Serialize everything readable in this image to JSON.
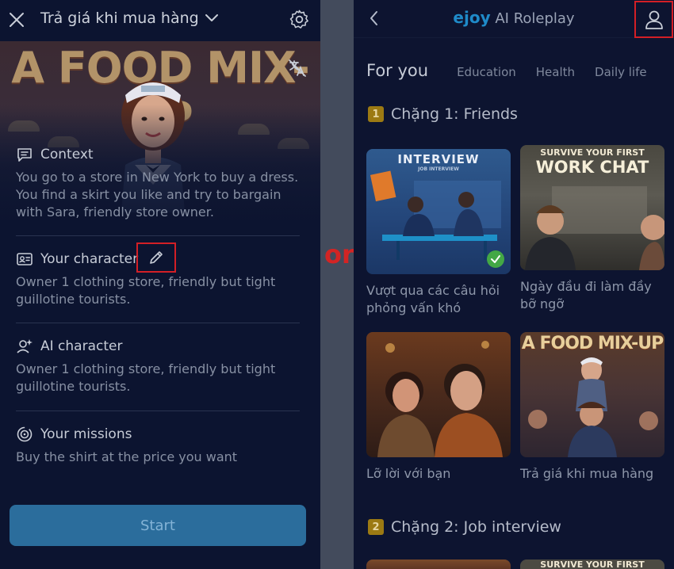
{
  "left": {
    "title": "Trả giá khi mua hàng",
    "hero_text": "A FOOD MIX-UP",
    "sections": [
      {
        "icon": "context-icon",
        "label": "Context",
        "body": "You go to a store in New York to buy a dress. You find a skirt you like and try to bargain with Sara, friendly store owner."
      },
      {
        "icon": "your-character-icon",
        "label": "Your character",
        "body": "Owner 1 clothing store, friendly but tight guillotine tourists."
      },
      {
        "icon": "ai-character-icon",
        "label": "AI character",
        "body": "Owner 1 clothing store, friendly but tight guillotine tourists."
      },
      {
        "icon": "missions-icon",
        "label": "Your missions",
        "body": "Buy the shirt at the price you want"
      }
    ],
    "start_label": "Start"
  },
  "separator_text": "or",
  "right": {
    "brand_logo": "ejoy",
    "brand_suffix": "AI Roleplay",
    "tabs": [
      {
        "label": "For you",
        "active": true
      },
      {
        "label": "Education",
        "active": false
      },
      {
        "label": "Health",
        "active": false
      },
      {
        "label": "Daily life",
        "active": false
      }
    ],
    "chapters": [
      {
        "num": "1",
        "title": "Chặng 1: Friends"
      },
      {
        "num": "2",
        "title": "Chặng 2: Job interview"
      }
    ],
    "cards": [
      {
        "image_text": "INTERVIEW",
        "image_subtext": "JOB INTERVIEW",
        "caption": "Vượt qua các câu hỏi phỏng vấn khó",
        "completed": true
      },
      {
        "image_text": "SURVIVE YOUR FIRST",
        "image_text2": "WORK CHAT",
        "caption": "Ngày đầu đi làm đầy bỡ ngỡ",
        "completed": false
      },
      {
        "caption": "Lỡ lời với bạn",
        "completed": false
      },
      {
        "image_text": "A FOOD MIX-UP",
        "caption": "Trả giá khi mua hàng",
        "completed": false
      }
    ],
    "peek_text": "SURVIVE YOUR FIRST"
  },
  "colors": {
    "highlight": "#d31f26",
    "start_button": "#2b6d9c",
    "brand": "#1f8bc9",
    "check": "#43a845",
    "chapter_badge": "#9c7a13"
  }
}
